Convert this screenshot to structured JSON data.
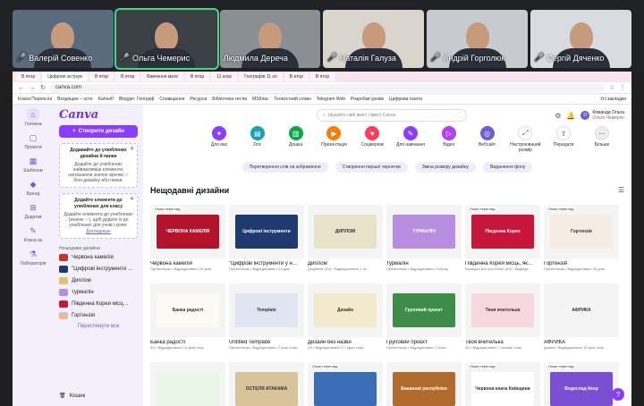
{
  "participants": [
    {
      "name": "Валерій Совенко",
      "muted": true
    },
    {
      "name": "Ольга Чемерис",
      "muted": true
    },
    {
      "name": "Людмила Дереча",
      "muted": false
    },
    {
      "name": "Наталія Галуза",
      "muted": true
    },
    {
      "name": "Андрій Горголюк",
      "muted": true
    },
    {
      "name": "Сергій Дяченко",
      "muted": true
    }
  ],
  "browser": {
    "tabs": [
      "В ятор",
      "Цифрові інструм",
      "В ятор",
      "В ятор",
      "Вивчення мате",
      "В ятор",
      "11 клас",
      "Географія 11 кл",
      "В ятор",
      "В ятор"
    ],
    "url": "canva.com",
    "bookmarks": [
      "Класи Переясла",
      "Входящие – осте",
      "Kahoot!",
      "Blogger: Географ",
      "Сповіщення",
      "Ресурси",
      "Бібліотека тестів",
      "MSКлас",
      "Геокостний словн",
      "Telegram Web",
      "Розробки уроків",
      "Цифрова освіта"
    ],
    "all_bookmarks": "Усі закладки"
  },
  "rail": [
    {
      "label": "Головна",
      "icon": "⌂"
    },
    {
      "label": "Проєкти",
      "icon": "▢"
    },
    {
      "label": "Шаблони",
      "icon": "▦"
    },
    {
      "label": "Бренд",
      "icon": "◆"
    },
    {
      "label": "Додатки",
      "icon": "⊞"
    },
    {
      "label": "Класи за",
      "icon": "✎"
    },
    {
      "label": "Лабораторія",
      "icon": "⚗"
    }
  ],
  "sidebar": {
    "logo": "Canva",
    "create_label": "Створити дизайн",
    "promo1_title": "Додавайте до улюблених дизайни й папки",
    "promo1_text": "Додайте до улюблених найважливіші елементи, натискаючи значок зірочки ☆ біля дизайну або папки.",
    "promo2_title": "Додайте елементи до улюблених для класу",
    "promo2_text": "Додайте елементи до улюблених (значок ☆), щоб додати їх до улюблених для учнів і колег.",
    "promo2_link": "Докладніше",
    "recent_heading": "Нещодавні дизайни",
    "recent": [
      "Червона камелія",
      "\"Цифрові інструменти …",
      "Диплом",
      "турмалін",
      "Південна Корея місц…",
      "Гортензія"
    ],
    "see_all": "Переглянути все",
    "trash": "Кошик"
  },
  "topbar": {
    "search_placeholder": "Шукайте свій вміст і вміст Canva",
    "team_name": "Команда Ольга",
    "team_sub": "Ольга Чемерис"
  },
  "categories": [
    {
      "label": "Для вас",
      "color": "#8b3dff"
    },
    {
      "label": "Doc",
      "color": "#13a3b5"
    },
    {
      "label": "Дошка",
      "color": "#0ba84a"
    },
    {
      "label": "Презентація",
      "color": "#ff7a00"
    },
    {
      "label": "Соцмережі",
      "color": "#ff3b5c"
    },
    {
      "label": "Для навчання",
      "color": "#8b3dff"
    },
    {
      "label": "Відео",
      "color": "#b13dff"
    },
    {
      "label": "Вебсайт",
      "color": "#6b5ed8"
    },
    {
      "label": "Настроюваний розмір",
      "color": "#ffffff"
    },
    {
      "label": "Передати",
      "color": "#ffffff"
    },
    {
      "label": "Більше",
      "color": "#eeeeee"
    }
  ],
  "chips": [
    "Перетворення слів на зображення",
    "Створення першої чернетки",
    "Зміна розміру дизайну",
    "Видалення фону"
  ],
  "section_title": "Нещодавні дизайни",
  "designs": [
    {
      "title": "Червона камелія",
      "meta": "Презентація • Відредаговано 26 днів",
      "badge": "Лише перегляд",
      "color": "#b3122b",
      "label": "ЧЕРВОНА КАМЕЛІЯ"
    },
    {
      "title": "\"Цифрові інструменти у на…",
      "meta": "Презентація • Відредаговано 3 годин",
      "badge": "",
      "color": "#1e3a6e",
      "label": "Цифрові інструменти"
    },
    {
      "title": "Диплом",
      "meta": "Документ (А4) • Відредаговано 1 хв",
      "badge": "",
      "color": "#e8e2c8",
      "label": "ДИПЛОМ"
    },
    {
      "title": "турмалін",
      "meta": "Презентація • Відредаговано 4 місяці",
      "badge": "",
      "color": "#b88fe0",
      "label": "ТУРМАЛІН"
    },
    {
      "title": "Південна Корея місць, як…",
      "meta": "Брошура (на три сгини) (А3) • Відреда",
      "badge": "Лише перегляд",
      "color": "#c6173b",
      "label": "Південна Корея"
    },
    {
      "title": "Гортензія",
      "meta": "Презентація • Відредаговано 28 днів",
      "badge": "Лише перегляд",
      "color": "#f5ece4",
      "label": "Гортензія"
    },
    {
      "title": "Банка радості",
      "meta": "А4 • Відредаговано 14 днів тому",
      "badge": "",
      "color": "#fbfaf5",
      "label": "Банка радості"
    },
    {
      "title": "Untitled Template",
      "meta": "Презентація • Відредаговано 2 роки тому",
      "badge": "",
      "color": "#dfe6f2",
      "label": "Template"
    },
    {
      "title": "Дизайн без назви",
      "meta": "А4 • Відредаговано 17 годин тому",
      "badge": "",
      "color": "#f3e9cc",
      "label": "Дизайн"
    },
    {
      "title": "Груповий проєкт",
      "meta": "Презентація • Відредаговано 2 роки",
      "badge": "",
      "color": "#3d8c4a",
      "label": "Груповий проєкт"
    },
    {
      "title": "Твоя вчителька",
      "meta": "А4 • Відредаговано 7 місяців тому",
      "badge": "",
      "color": "#f7d8df",
      "label": "Твоя вчителька"
    },
    {
      "title": "АФРИКА",
      "meta": "Дошка • Відредаговано 14 днів тому",
      "badge": "",
      "color": "#f4f4f4",
      "label": "АФРИКА"
    },
    {
      "title": "",
      "meta": "",
      "badge": "",
      "color": "#e9f5e6",
      "label": ""
    },
    {
      "title": "",
      "meta": "",
      "badge": "",
      "color": "#d8c39a",
      "label": "ОСТЕЛЯ АТАКАМА"
    },
    {
      "title": "",
      "meta": "",
      "badge": "Лише перегляд",
      "color": "#3a6db5",
      "label": ""
    },
    {
      "title": "",
      "meta": "",
      "badge": "",
      "color": "#b06b2c",
      "label": "Бананові республіки"
    },
    {
      "title": "",
      "meta": "",
      "badge": "Лише перегляд",
      "color": "#ffffff",
      "label": "Червона книга Київщини"
    },
    {
      "title": "",
      "meta": "",
      "badge": "Лише перегляд",
      "color": "#7b4fd1",
      "label": "Водоспад Кеєр"
    }
  ],
  "help_icon": "?"
}
